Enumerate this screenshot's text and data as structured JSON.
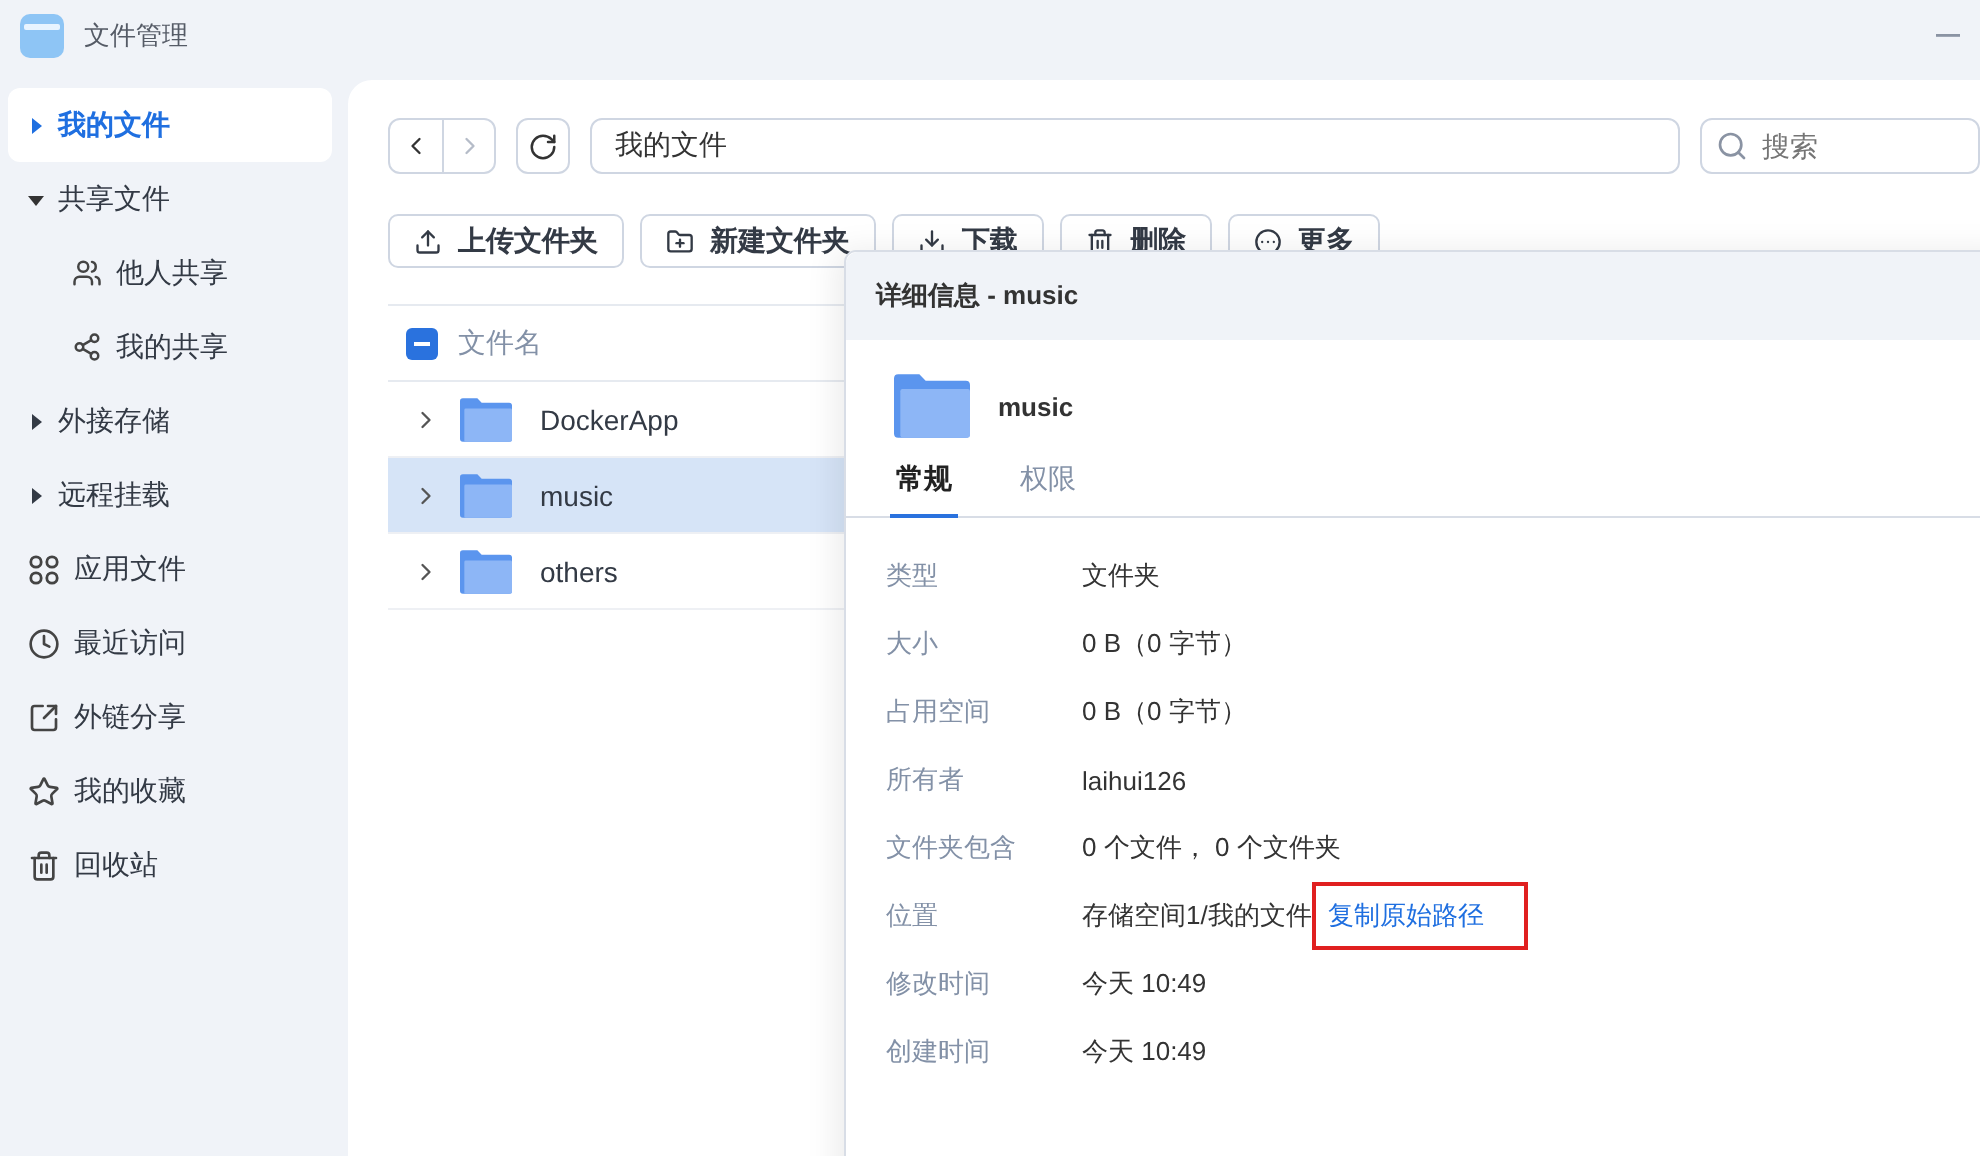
{
  "window": {
    "title": "文件管理"
  },
  "sidebar": {
    "items": [
      {
        "kind": "group",
        "label": "我的文件",
        "selected": true,
        "expanded": false
      },
      {
        "kind": "group",
        "label": "共享文件",
        "selected": false,
        "expanded": true,
        "children": [
          {
            "label": "他人共享",
            "selected": false
          },
          {
            "label": "我的共享",
            "selected": false
          }
        ]
      },
      {
        "kind": "group",
        "label": "外接存储",
        "selected": false,
        "expanded": false
      },
      {
        "kind": "group",
        "label": "远程挂载",
        "selected": false,
        "expanded": false
      },
      {
        "kind": "link",
        "label": "应用文件",
        "selected": false
      },
      {
        "kind": "link",
        "label": "最近访问",
        "selected": false
      },
      {
        "kind": "link",
        "label": "外链分享",
        "selected": false
      },
      {
        "kind": "link",
        "label": "我的收藏",
        "selected": false
      },
      {
        "kind": "link",
        "label": "回收站",
        "selected": false
      }
    ]
  },
  "path": {
    "value": "我的文件"
  },
  "search": {
    "placeholder": "搜索"
  },
  "toolbar": [
    "上传文件夹",
    "新建文件夹",
    "下载",
    "删除",
    "更多"
  ],
  "table": {
    "columns": [
      "文件名"
    ],
    "select_all_indeterminate": true,
    "rows": [
      {
        "name": "DockerApp",
        "selected": false
      },
      {
        "name": "music",
        "selected": true
      },
      {
        "name": "others",
        "selected": false
      }
    ]
  },
  "details": {
    "title": "详细信息 - music",
    "name": "music",
    "tabs": [
      {
        "label": "常规",
        "selected": true
      },
      {
        "label": "权限",
        "selected": false
      }
    ],
    "properties": [
      {
        "label": "类型",
        "value": "文件夹"
      },
      {
        "label": "大小",
        "value": "0 B（0 字节）"
      },
      {
        "label": "占用空间",
        "value": "0 B（0 字节）"
      },
      {
        "label": "所有者",
        "value": "laihui126"
      },
      {
        "label": "文件夹包含",
        "value": "0 个文件， 0 个文件夹"
      },
      {
        "label": "位置",
        "value": "存储空间1/我的文件",
        "link": "复制原始路径",
        "highlighted": true
      },
      {
        "label": "修改时间",
        "value": "今天 10:49"
      },
      {
        "label": "创建时间",
        "value": "今天 10:49"
      }
    ]
  }
}
